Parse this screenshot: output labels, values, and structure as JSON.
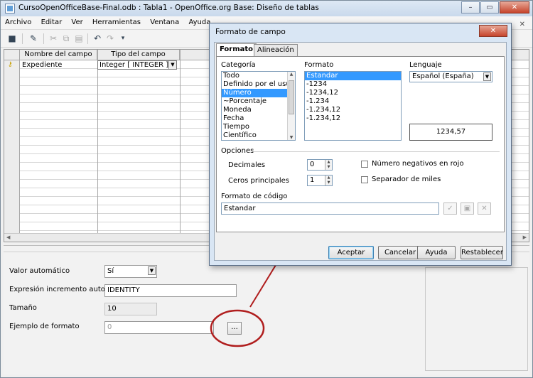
{
  "window": {
    "title": "CursoOpenOfficeBase-Final.odb : Tabla1 - OpenOffice.org Base: Diseño de tablas",
    "minimize": "–",
    "maximize": "▭",
    "close": "✕"
  },
  "menu": {
    "items": [
      "Archivo",
      "Editar",
      "Ver",
      "Herramientas",
      "Ventana",
      "Ayuda"
    ],
    "close_doc": "✕"
  },
  "grid": {
    "columns": [
      "Nombre del campo",
      "Tipo del campo"
    ],
    "rows": [
      {
        "name": "Expediente",
        "type": "Integer [ INTEGER ]"
      }
    ]
  },
  "properties": {
    "auto_value_label": "Valor automático",
    "auto_value": "Sí",
    "autoincrement_label": "Expresión incremento automát",
    "autoincrement": "IDENTITY",
    "size_label": "Tamaño",
    "size": "10",
    "format_example_label": "Ejemplo de formato",
    "format_example": "0",
    "format_button": "..."
  },
  "dialog": {
    "title": "Formato de campo",
    "close": "✕",
    "tabs": [
      "Formato",
      "Alineación"
    ],
    "category_label": "Categoría",
    "categories": [
      "Todo",
      "Definido por el usuario",
      "Número",
      "~Porcentaje",
      "Moneda",
      "Fecha",
      "Tiempo",
      "Científico"
    ],
    "category_selected": 2,
    "format_label": "Formato",
    "formats": [
      "Estandar",
      "-1234",
      "-1234,12",
      "-1.234",
      "-1.234,12",
      "-1.234,12"
    ],
    "format_selected": 0,
    "language_label": "Lenguaje",
    "language": "Español (España)",
    "preview": "1234,57",
    "options_label": "Opciones",
    "decimals_label": "Decimales",
    "decimals": "0",
    "leading_zeros_label": "Ceros principales",
    "leading_zeros": "1",
    "negative_red_label": "Número negativos en rojo",
    "thousands_sep_label": "Separador de miles",
    "format_code_label": "Formato de código",
    "format_code": "Estandar",
    "buttons": {
      "ok": "Aceptar",
      "cancel": "Cancelar",
      "help": "Ayuda",
      "reset": "Restablecer"
    }
  },
  "colors": {
    "selection": "#3399ff",
    "callout": "#b01e1e",
    "dialog_frame": "#d9e6f4"
  }
}
